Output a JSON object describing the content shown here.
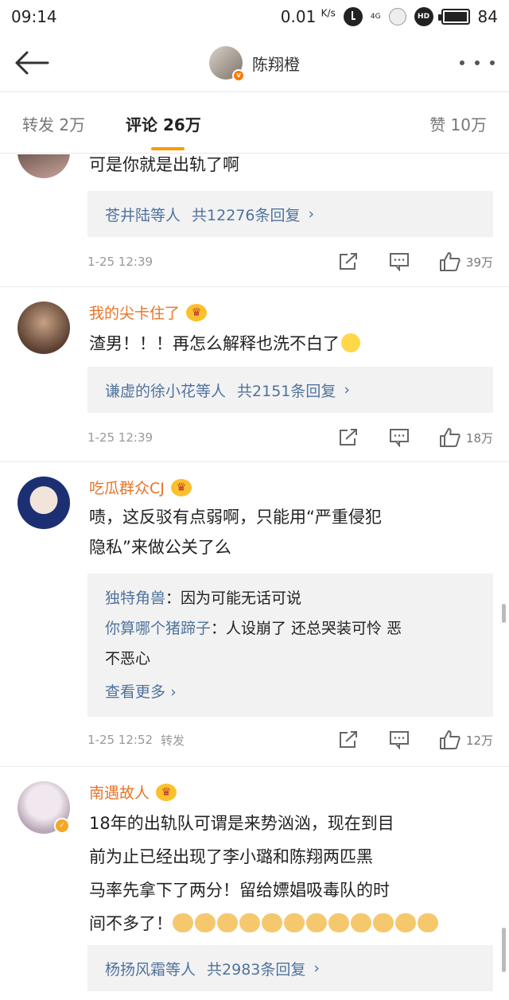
{
  "status_bar": {
    "time": "09:14",
    "speed": "0.01",
    "speed_unit": "K/s",
    "network": "4G",
    "hd": "HD",
    "battery": "84"
  },
  "header": {
    "title": "陈翔橙"
  },
  "tabs": {
    "repost": "转发 2万",
    "comment": "评论 26万",
    "like": "赞 10万"
  },
  "comments": [
    {
      "text": "可是你就是出轨了啊",
      "reply_users": "苍井陆等人",
      "reply_count": "共12276条回复",
      "time": "1-25 12:39",
      "likes": "39万"
    },
    {
      "username": "我的尖卡住了",
      "text": "渣男！！！再怎么解释也洗不白了",
      "reply_users": "谦虚的徐小花等人",
      "reply_count": "共2151条回复",
      "time": "1-25 12:39",
      "likes": "18万"
    },
    {
      "username": "吃瓜群众CJ",
      "text_line1": "啧，这反驳有点弱啊，只能用“严重侵犯",
      "text_line2": "隐私”来做公关了么",
      "reply1_user": "独特角兽",
      "reply1_text": "：因为可能无话可说",
      "reply2_user": "你算哪个猪蹄子",
      "reply2_text": "：人设崩了 还总哭装可怜 恶",
      "reply2_text2": "不恶心",
      "view_more": "查看更多",
      "time": "1-25 12:52",
      "repost_tag": "转发",
      "likes": "12万"
    },
    {
      "username": "南遇故人",
      "text_line1": "18年的出轨队可谓是来势汹汹，现在到目",
      "text_line2": "前为止已经出现了李小璐和陈翔两匹黑",
      "text_line3": "马率先拿下了两分！留给嫖娼吸毒队的时",
      "text_line4": "间不多了！",
      "reply_users": "杨扬风霜等人",
      "reply_count": "共2983条回复"
    }
  ]
}
